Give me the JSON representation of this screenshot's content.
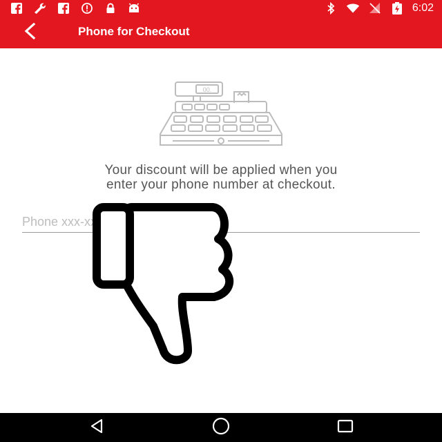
{
  "status_bar": {
    "time": "6:02",
    "left_icons": [
      "facebook-icon",
      "wrench-icon",
      "facebook-icon",
      "alert-icon",
      "lock-icon",
      "android-icon"
    ],
    "right_icons": [
      "bluetooth-icon",
      "wifi-icon",
      "no-signal-icon",
      "battery-charging-icon"
    ]
  },
  "toolbar": {
    "title": "Phone for Checkout",
    "back_icon": "back-arrow-icon"
  },
  "main": {
    "illustration_icon": "cash-register-icon",
    "register_display": "00.",
    "message_line1": "Your discount will be applied when you",
    "message_line2": "enter your phone number at checkout.",
    "phone_placeholder": "Phone xxx-xxx-xxxx",
    "overlay_icon": "thumbs-down-icon"
  },
  "nav_bar": {
    "icons": [
      "back-triangle-icon",
      "home-circle-icon",
      "recents-square-icon"
    ]
  },
  "colors": {
    "brand": "#e3171f",
    "text": "#555555",
    "nav": "#000000"
  }
}
